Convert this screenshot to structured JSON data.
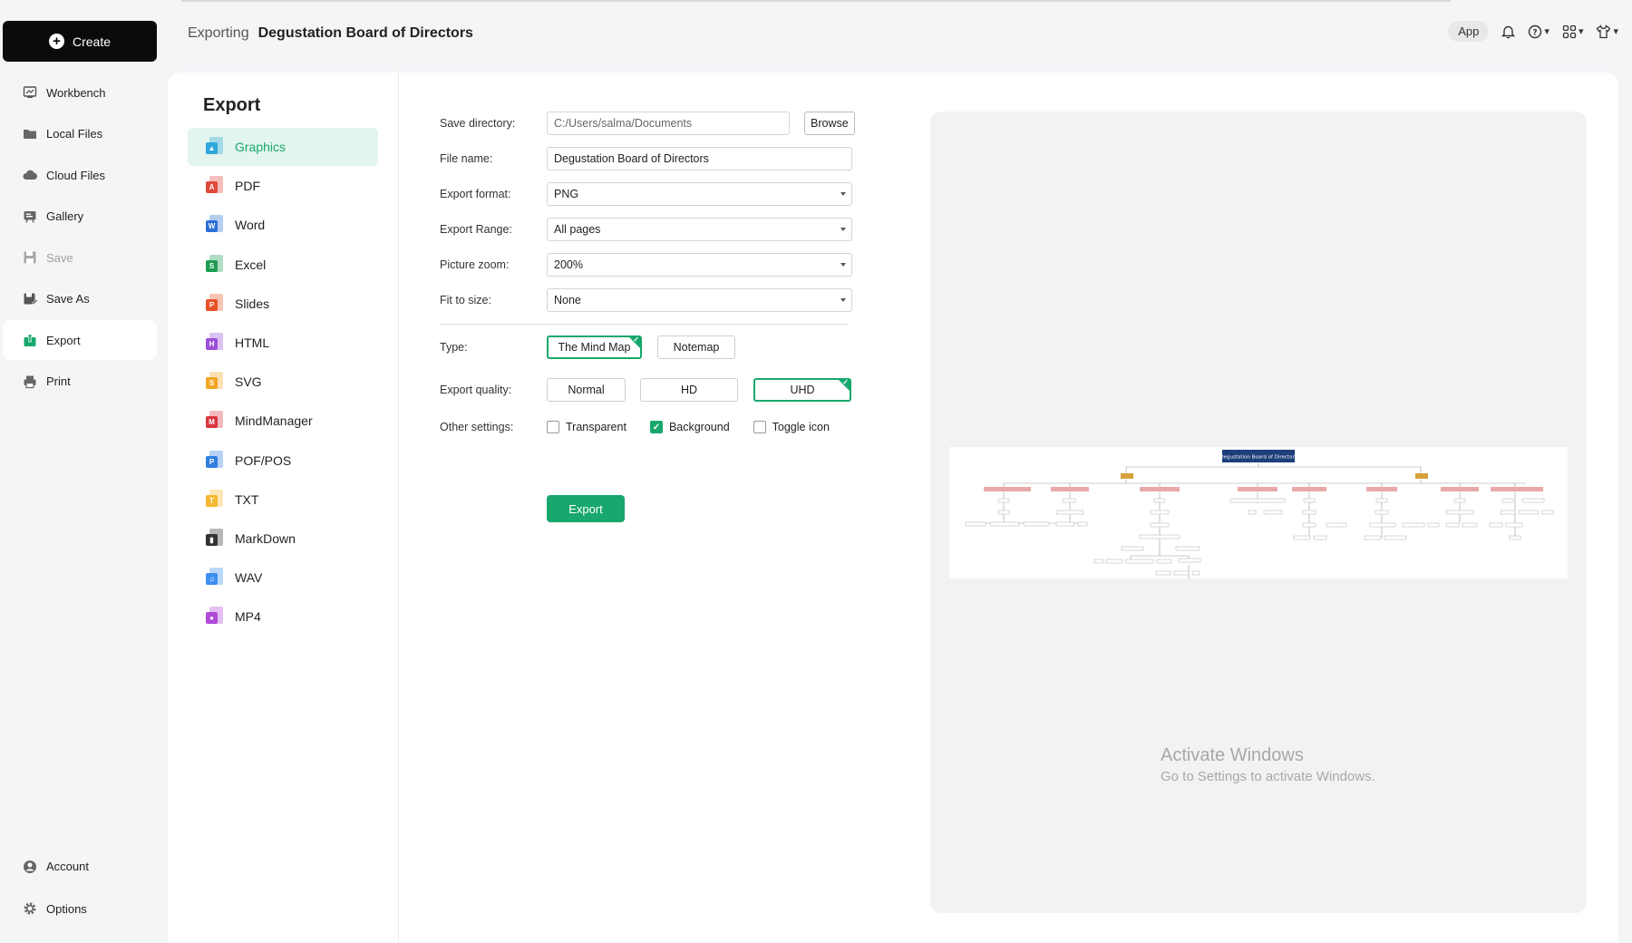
{
  "sidebar": {
    "create_label": "Create",
    "items": [
      {
        "label": "Workbench",
        "icon": "workbench-icon"
      },
      {
        "label": "Local Files",
        "icon": "folder-icon"
      },
      {
        "label": "Cloud Files",
        "icon": "cloud-icon"
      },
      {
        "label": "Gallery",
        "icon": "gallery-icon"
      },
      {
        "label": "Save",
        "icon": "save-icon",
        "disabled": true
      },
      {
        "label": "Save As",
        "icon": "save-as-icon"
      },
      {
        "label": "Export",
        "icon": "export-icon",
        "active": true
      },
      {
        "label": "Print",
        "icon": "print-icon"
      }
    ],
    "bottom": [
      {
        "label": "Account",
        "icon": "account-icon"
      },
      {
        "label": "Options",
        "icon": "gear-icon"
      }
    ]
  },
  "header": {
    "status": "Exporting",
    "document_title": "Degustation Board of Directors",
    "app_label": "App"
  },
  "export_panel": {
    "heading": "Export",
    "formats": [
      {
        "label": "Graphics",
        "color": "#2fa6d9",
        "glyph": "▲",
        "active": true
      },
      {
        "label": "PDF",
        "color": "#e0493b",
        "glyph": "A"
      },
      {
        "label": "Word",
        "color": "#2b6fd6",
        "glyph": "W"
      },
      {
        "label": "Excel",
        "color": "#1f9d55",
        "glyph": "S"
      },
      {
        "label": "Slides",
        "color": "#e8522a",
        "glyph": "P"
      },
      {
        "label": "HTML",
        "color": "#9b4fd8",
        "glyph": "H"
      },
      {
        "label": "SVG",
        "color": "#f0a623",
        "glyph": "S"
      },
      {
        "label": "MindManager",
        "color": "#d9363e",
        "glyph": "M"
      },
      {
        "label": "POF/POS",
        "color": "#2f7fe0",
        "glyph": "P"
      },
      {
        "label": "TXT",
        "color": "#f5b731",
        "glyph": "T"
      },
      {
        "label": "MarkDown",
        "color": "#333333",
        "glyph": "▮"
      },
      {
        "label": "WAV",
        "color": "#3d8ff0",
        "glyph": "♫"
      },
      {
        "label": "MP4",
        "color": "#b04ad8",
        "glyph": "●"
      }
    ]
  },
  "settings": {
    "save_directory": {
      "label": "Save directory:",
      "value": "C:/Users/salma/Documents",
      "browse_label": "Browse"
    },
    "file_name": {
      "label": "File name:",
      "value": "Degustation Board of Directors"
    },
    "export_format": {
      "label": "Export format:",
      "value": "PNG"
    },
    "export_range": {
      "label": "Export Range:",
      "value": "All pages"
    },
    "picture_zoom": {
      "label": "Picture zoom:",
      "value": "200%"
    },
    "fit_to_size": {
      "label": "Fit to size:",
      "value": "None"
    },
    "type": {
      "label": "Type:",
      "options": [
        "The Mind Map",
        "Notemap"
      ],
      "selected": "The Mind Map"
    },
    "export_quality": {
      "label": "Export quality:",
      "options": [
        "Normal",
        "HD",
        "UHD"
      ],
      "selected": "UHD"
    },
    "other_settings": {
      "label": "Other settings:",
      "options": [
        {
          "label": "Transparent",
          "checked": false
        },
        {
          "label": "Background",
          "checked": true
        },
        {
          "label": "Toggle icon",
          "checked": false
        }
      ]
    },
    "export_button": "Export"
  },
  "preview": {
    "root_title": "Degustation Board of Directors",
    "accent_color": "#18a86d",
    "root_color": "#1d3f7a",
    "branch_color": "#d6a03a",
    "dept_color": "#e9a9a9"
  },
  "watermark": {
    "line1": "Activate Windows",
    "line2": "Go to Settings to activate Windows."
  }
}
